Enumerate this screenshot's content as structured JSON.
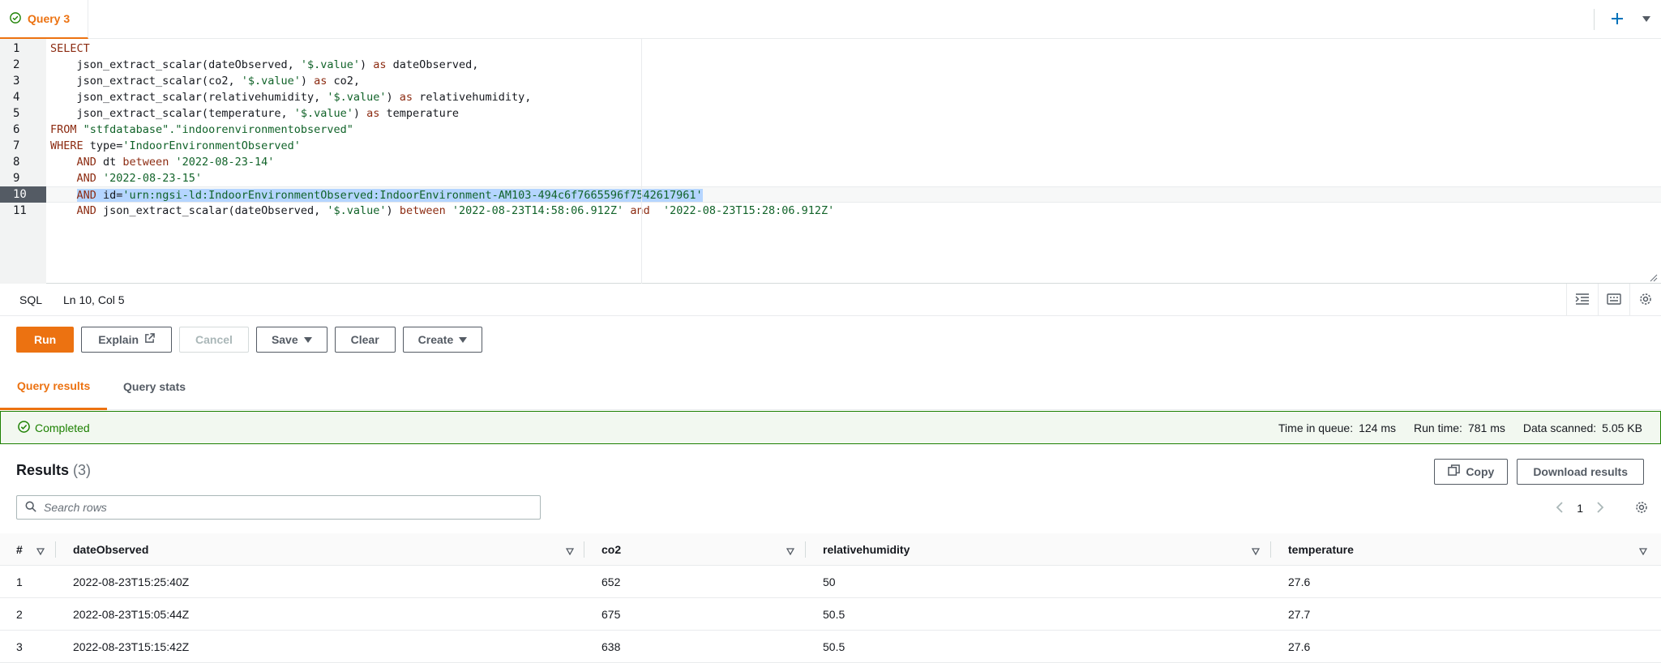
{
  "tab": {
    "label": "Query 3"
  },
  "editor": {
    "line_numbers": [
      "1",
      "2",
      "3",
      "4",
      "5",
      "6",
      "7",
      "8",
      "9",
      "10",
      "11"
    ],
    "active_line": 10
  },
  "statusbar": {
    "language": "SQL",
    "cursor": "Ln 10, Col 5"
  },
  "toolbar": {
    "run": "Run",
    "explain": "Explain",
    "cancel": "Cancel",
    "save": "Save",
    "clear": "Clear",
    "create": "Create"
  },
  "result_tabs": {
    "results": "Query results",
    "stats": "Query stats"
  },
  "status": {
    "text": "Completed",
    "time_in_queue_label": "Time in queue:",
    "time_in_queue": "124 ms",
    "run_time_label": "Run time:",
    "run_time": "781 ms",
    "data_scanned_label": "Data scanned:",
    "data_scanned": "5.05 KB"
  },
  "results": {
    "title": "Results",
    "count": "(3)",
    "copy": "Copy",
    "download": "Download results",
    "search_placeholder": "Search rows",
    "page": "1",
    "columns": [
      "#",
      "dateObserved",
      "co2",
      "relativehumidity",
      "temperature"
    ],
    "rows": [
      [
        "1",
        "2022-08-23T15:25:40Z",
        "652",
        "50",
        "27.6"
      ],
      [
        "2",
        "2022-08-23T15:05:44Z",
        "675",
        "50.5",
        "27.7"
      ],
      [
        "3",
        "2022-08-23T15:15:42Z",
        "638",
        "50.5",
        "27.6"
      ]
    ]
  },
  "colors": {
    "accent": "#ec7211",
    "success": "#1d8102",
    "selection": "#b5d5ff"
  },
  "code": {
    "l1": "SELECT",
    "l2_fn": "    json_extract_scalar(dateObserved, ",
    "l2_str": "'$.value'",
    "l2_rest": ") ",
    "l2_as": "as",
    "l2_alias": " dateObserved,",
    "l3_fn": "    json_extract_scalar(co2, ",
    "l3_str": "'$.value'",
    "l3_rest": ") ",
    "l3_as": "as",
    "l3_alias": " co2,",
    "l4_fn": "    json_extract_scalar(relativehumidity, ",
    "l4_str": "'$.value'",
    "l4_rest": ") ",
    "l4_as": "as",
    "l4_alias": " relativehumidity,",
    "l5_fn": "    json_extract_scalar(temperature, ",
    "l5_str": "'$.value'",
    "l5_rest": ") ",
    "l5_as": "as",
    "l5_alias": " temperature",
    "l6_kw": "FROM",
    "l6_str": " \"stfdatabase\".\"indoorenvironmentobserved\"",
    "l7_kw": "WHERE",
    "l7_mid": " type=",
    "l7_str": "'IndoorEnvironmentObserved'",
    "l8_pre": "    ",
    "l8_kw": "AND",
    "l8_mid": " dt ",
    "l8_kw2": "between",
    "l8_sp": " ",
    "l8_str": "'2022-08-23-14'",
    "l9_pre": "    ",
    "l9_kw": "AND",
    "l9_sp": " ",
    "l9_str": "'2022-08-23-15'",
    "l10_pre": "    ",
    "l10_kw": "AND",
    "l10_mid": " id=",
    "l10_str": "'urn:ngsi-ld:IndoorEnvironmentObserved:IndoorEnvironment-AM103-494c6f7665596f7542617961'",
    "l11_pre": "    ",
    "l11_kw": "AND",
    "l11_mid": " json_extract_scalar(dateObserved, ",
    "l11_str1": "'$.value'",
    "l11_rest": ") ",
    "l11_kw2": "between",
    "l11_sp": " ",
    "l11_str2": "'2022-08-23T14:58:06.912Z'",
    "l11_sp2": " ",
    "l11_kw3": "and",
    "l11_sp3": "  ",
    "l11_str3": "'2022-08-23T15:28:06.912Z'"
  }
}
